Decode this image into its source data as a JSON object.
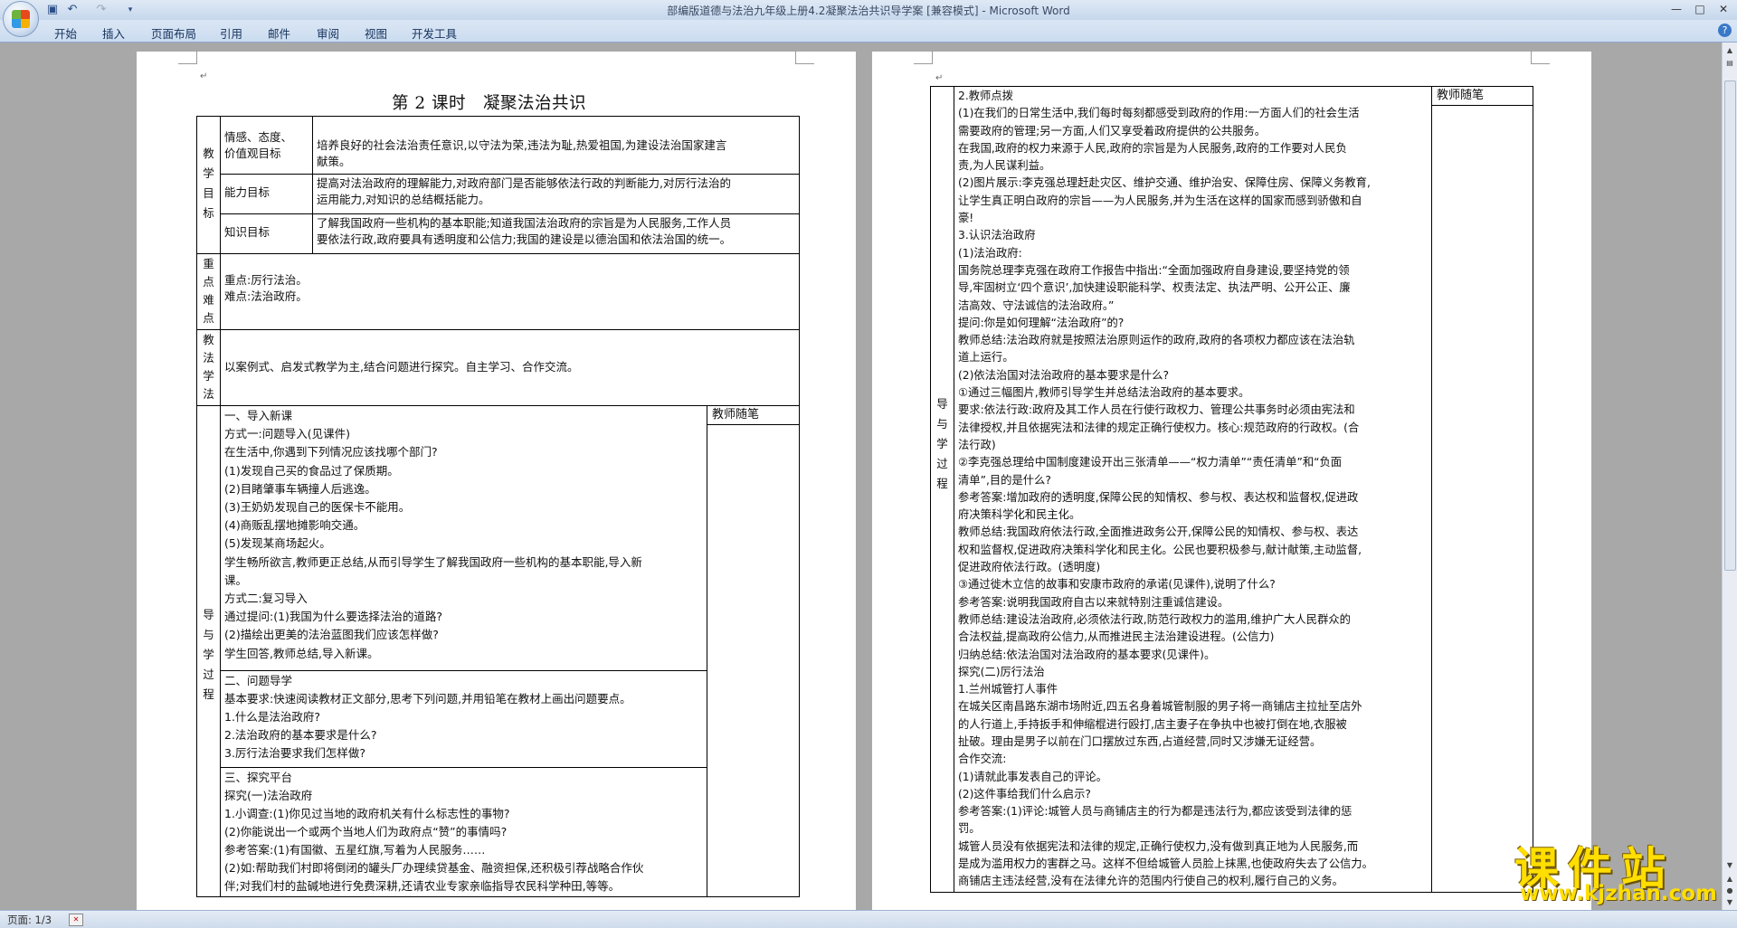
{
  "window": {
    "title": "部编版道德与法治九年级上册4.2凝聚法治共识导学案 [兼容模式] - Microsoft Word",
    "minimize": "—",
    "maximize": "□",
    "close": "✕"
  },
  "quick_access": {
    "save_icon": "save-icon",
    "undo_icon": "undo-icon",
    "redo_icon": "redo-icon",
    "customize_icon": "customize-icon"
  },
  "ribbon": {
    "tabs": [
      "开始",
      "插入",
      "页面布局",
      "引用",
      "邮件",
      "审阅",
      "视图",
      "开发工具"
    ],
    "help": "?"
  },
  "status": {
    "page_count": "页面: 1/3"
  },
  "watermark": {
    "title": "课件站",
    "url": "www.kjzhan.com"
  },
  "page1": {
    "title": "第 2 课时　凝聚法治共识",
    "objectives_label": [
      "教",
      "学",
      "目",
      "标"
    ],
    "objectives": [
      {
        "label": [
          "情感、态度、",
          "价值观目标"
        ],
        "text": [
          "培养良好的社会法治责任意识,以守法为荣,违法为耻,热爱祖国,为建设法治国家建言",
          "献策。"
        ]
      },
      {
        "label": [
          "能力目标"
        ],
        "text": [
          "提高对法治政府的理解能力,对政府部门是否能够依法行政的判断能力,对厉行法治的",
          "运用能力,对知识的总结概括能力。"
        ]
      },
      {
        "label": [
          "知识目标"
        ],
        "text": [
          "了解我国政府一些机构的基本职能;知道我国法治政府的宗旨是为人民服务,工作人员",
          "要依法行政,政府要具有透明度和公信力;我国的建设是以德治国和依法治国的统一。"
        ]
      }
    ],
    "key_label": [
      "重",
      "点",
      "难",
      "点"
    ],
    "key_points": [
      "重点:厉行法治。",
      "难点:法治政府。"
    ],
    "method_label": [
      "教",
      "法",
      "学",
      "法"
    ],
    "method_text": "以案例式、启发式教学为主,结合问题进行探究。自主学习、合作交流。",
    "process_label": [
      "导",
      "与",
      "学",
      "过",
      "程"
    ],
    "notes_header": "教师随笔",
    "section1": [
      "一、导入新课",
      "方式一:问题导入(见课件)",
      "在生活中,你遇到下列情况应该找哪个部门?",
      "(1)发现自己买的食品过了保质期。",
      "(2)目睹肇事车辆撞人后逃逸。",
      "(3)王奶奶发现自己的医保卡不能用。",
      "(4)商贩乱摆地摊影响交通。",
      "(5)发现某商场起火。",
      "学生畅所欲言,教师更正总结,从而引导学生了解我国政府一些机构的基本职能,导入新",
      "课。",
      "方式二:复习导入",
      "通过提问:(1)我国为什么要选择法治的道路?",
      "(2)描绘出更美的法治蓝图我们应该怎样做?",
      "学生回答,教师总结,导入新课。"
    ],
    "section2": [
      "二、问题导学",
      "基本要求:快速阅读教材正文部分,思考下列问题,并用铅笔在教材上画出问题要点。",
      "1.什么是法治政府?",
      "2.法治政府的基本要求是什么?",
      "3.厉行法治要求我们怎样做?"
    ],
    "section3": [
      "三、探究平台",
      "探究(一)法治政府",
      "1.小调查:(1)你见过当地的政府机关有什么标志性的事物?",
      "(2)你能说出一个或两个当地人们为政府点“赞”的事情吗?",
      "参考答案:(1)有国徽、五星红旗,写着为人民服务……",
      "(2)如:帮助我们村即将倒闭的罐头厂办理续贷基金、融资担保,还积极引荐战略合作伙",
      "伴;对我们村的盐碱地进行免费深耕,还请农业专家亲临指导农民科学种田,等等。"
    ]
  },
  "page2": {
    "notes_header": "教师随笔",
    "process_label": [
      "导",
      "与",
      "学",
      "过",
      "程"
    ],
    "lines": [
      "2.教师点拨",
      "(1)在我们的日常生活中,我们每时每刻都感受到政府的作用:一方面人们的社会生活",
      "需要政府的管理;另一方面,人们又享受着政府提供的公共服务。",
      "在我国,政府的权力来源于人民,政府的宗旨是为人民服务,政府的工作要对人民负",
      "责,为人民谋利益。",
      "(2)图片展示:李克强总理赶赴灾区、维护交通、维护治安、保障住房、保障义务教育,",
      "让学生真正明白政府的宗旨——为人民服务,并为生活在这样的国家而感到骄傲和自",
      "豪!",
      "3.认识法治政府",
      "(1)法治政府:",
      "国务院总理李克强在政府工作报告中指出:“全面加强政府自身建设,要坚持党的领",
      "导,牢固树立‘四个意识’,加快建设职能科学、权责法定、执法严明、公开公正、廉",
      "洁高效、守法诚信的法治政府。”",
      "提问:你是如何理解“法治政府”的?",
      "教师总结:法治政府就是按照法治原则运作的政府,政府的各项权力都应该在法治轨",
      "道上运行。",
      "(2)依法治国对法治政府的基本要求是什么?",
      "①通过三幅图片,教师引导学生并总结法治政府的基本要求。",
      "要求:依法行政:政府及其工作人员在行使行政权力、管理公共事务时必须由宪法和",
      "法律授权,并且依据宪法和法律的规定正确行使权力。核心:规范政府的行政权。(合",
      "法行政)",
      "②李克强总理给中国制度建设开出三张清单——“权力清单”“责任清单”和“负面",
      "清单”,目的是什么?",
      "参考答案:增加政府的透明度,保障公民的知情权、参与权、表达权和监督权,促进政",
      "府决策科学化和民主化。",
      "教师总结:我国政府依法行政,全面推进政务公开,保障公民的知情权、参与权、表达",
      "权和监督权,促进政府决策科学化和民主化。公民也要积极参与,献计献策,主动监督,",
      "促进政府依法行政。(透明度)",
      "③通过徙木立信的故事和安康市政府的承诺(见课件),说明了什么?",
      "参考答案:说明我国政府自古以来就特别注重诚信建设。",
      "教师总结:建设法治政府,必须依法行政,防范行政权力的滥用,维护广大人民群众的",
      "合法权益,提高政府公信力,从而推进民主法治建设进程。(公信力)",
      "归纳总结:依法治国对法治政府的基本要求(见课件)。",
      "探究(二)厉行法治",
      "1.兰州城管打人事件",
      "在城关区南昌路东湖市场附近,四五名身着城管制服的男子将一商铺店主拉扯至店外",
      "的人行道上,手持扳手和伸缩棍进行殴打,店主妻子在争执中也被打倒在地,衣服被",
      "扯破。理由是男子以前在门口摆放过东西,占道经营,同时又涉嫌无证经营。",
      "合作交流:",
      "(1)请就此事发表自己的评论。",
      "(2)这件事给我们什么启示?",
      "参考答案:(1)评论:城管人员与商铺店主的行为都是违法行为,都应该受到法律的惩",
      "罚。",
      "城管人员没有依据宪法和法律的规定,正确行使权力,没有做到真正地为人民服务,而",
      "是成为滥用权力的害群之马。这样不但给城管人员脸上抹黑,也使政府失去了公信力。",
      "商铺店主违法经营,没有在法律允许的范围内行使自己的权利,履行自己的义务。"
    ]
  }
}
